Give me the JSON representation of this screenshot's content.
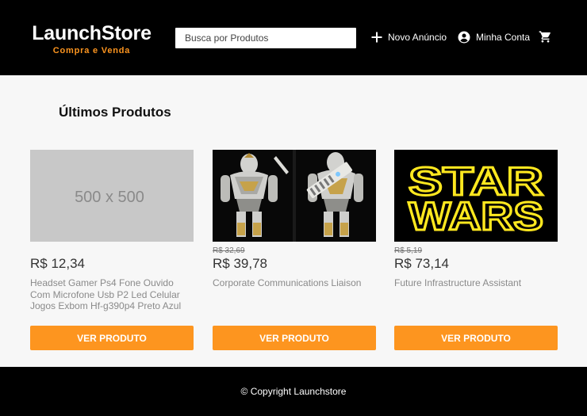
{
  "header": {
    "logo_title": "LaunchStore",
    "logo_subtitle": "Compra e Venda",
    "search_placeholder": "Busca por Produtos",
    "new_ad_label": "Novo Anúncio",
    "new_ad_icon": "plus-icon",
    "account_label": "Minha Conta",
    "account_icon": "account-circle-icon",
    "cart_icon": "shopping-cart-icon"
  },
  "main": {
    "section_title": "Últimos Produtos",
    "products": [
      {
        "image_label": "500 x 500",
        "image_kind": "placeholder",
        "old_price": "",
        "price": "R$ 12,34",
        "name": "Headset Gamer Ps4 Fone Ouvido Com Microfone Usb P2 Led Celular Jogos Exbom Hf-g390p4 Preto Azul",
        "button_label": "VER PRODUTO"
      },
      {
        "image_label": "",
        "image_kind": "armored-figures-photo",
        "old_price": "R$ 32,69",
        "price": "R$ 39,78",
        "name": "Corporate Communications Liaison",
        "button_label": "VER PRODUTO"
      },
      {
        "image_label": "",
        "image_kind": "star-wars-logo",
        "old_price": "R$ 5,19",
        "price": "R$ 73,14",
        "name": "Future Infrastructure Assistant",
        "button_label": "VER PRODUTO"
      }
    ]
  },
  "footer": {
    "copyright": "© Copyright Launchstore"
  },
  "colors": {
    "header_bg": "#000000",
    "accent": "#fd951f",
    "content_bg": "#f7f7f7",
    "placeholder_bg": "#c8c8c8"
  }
}
